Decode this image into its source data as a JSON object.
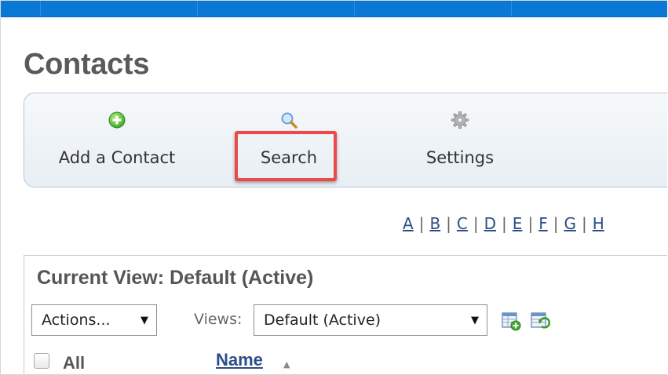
{
  "page": {
    "title": "Contacts"
  },
  "toolbar": {
    "add_label": "Add a Contact",
    "search_label": "Search",
    "settings_label": "Settings",
    "icons": {
      "add": "plus-circle-icon",
      "search": "magnifier-icon",
      "settings": "gear-icon"
    }
  },
  "alphabet": [
    "A",
    "B",
    "C",
    "D",
    "E",
    "F",
    "G",
    "H"
  ],
  "view": {
    "title": "Current View: Default (Active)",
    "actions_value": "Actions...",
    "views_label": "Views:",
    "views_value": "Default (Active)"
  },
  "grid": {
    "select_all_label": "All",
    "name_header": "Name"
  },
  "colors": {
    "topbar": "#0a79d6",
    "highlight": "#ea4a4a",
    "link": "#2c4e86"
  }
}
